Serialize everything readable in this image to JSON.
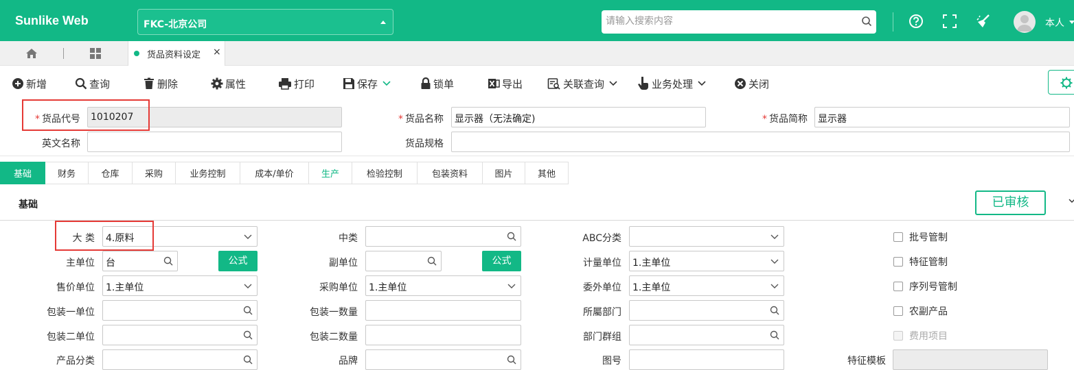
{
  "app": {
    "brand": "Sunlike Web",
    "company": "FKC-北京公司",
    "search_placeholder": "请输入搜索内容",
    "user_name": "本人",
    "accent_color": "#12b886"
  },
  "tabs": {
    "current_doc": "货品资料设定",
    "close_glyph": "×"
  },
  "toolbar": {
    "items": [
      {
        "label": "新增",
        "icon": "plus-circle-icon"
      },
      {
        "label": "查询",
        "icon": "search-icon"
      },
      {
        "label": "删除",
        "icon": "trash-icon"
      },
      {
        "label": "属性",
        "icon": "gear-icon"
      },
      {
        "label": "打印",
        "icon": "printer-icon"
      },
      {
        "label": "保存",
        "icon": "save-icon"
      },
      {
        "label": "锁单",
        "icon": "lock-icon"
      },
      {
        "label": "导出",
        "icon": "excel-icon"
      },
      {
        "label": "关联查询",
        "icon": "related-query-icon"
      },
      {
        "label": "业务处理",
        "icon": "hand-icon"
      },
      {
        "label": "关闭",
        "icon": "close-circle-icon"
      }
    ]
  },
  "header_form": {
    "item_code_label": "货品代号",
    "item_code_value": "1010207",
    "item_name_label": "货品名称",
    "item_name_value": "显示器（无法确定)",
    "item_short_label": "货品简称",
    "item_short_value": "显示器",
    "english_name_label": "英文名称",
    "english_name_value": "",
    "spec_label": "货品规格",
    "spec_value": "",
    "required_mark": "*"
  },
  "subtabs": [
    "基础",
    "财务",
    "仓库",
    "采购",
    "业务控制",
    "成本/单价",
    "生产",
    "检验控制",
    "包装资料",
    "图片",
    "其他"
  ],
  "section": {
    "title": "基础",
    "status": "已审核"
  },
  "basic": {
    "major_class_label": "大 类",
    "major_class_value": "4.原料",
    "mid_class_label": "中类",
    "mid_class_value": "",
    "abc_label": "ABC分类",
    "abc_value": "",
    "main_unit_label": "主单位",
    "main_unit_value": "台",
    "formula_label": "公式",
    "sub_unit_label": "副单位",
    "sub_unit_value": "",
    "measure_unit_label": "计量单位",
    "measure_unit_value": "1.主单位",
    "sale_unit_label": "售价单位",
    "sale_unit_value": "1.主单位",
    "purchase_unit_label": "采购单位",
    "purchase_unit_value": "1.主单位",
    "outsource_unit_label": "委外单位",
    "outsource_unit_value": "1.主单位",
    "pack1_unit_label": "包装一单位",
    "pack1_unit_value": "",
    "pack1_qty_label": "包装一数量",
    "pack1_qty_value": "",
    "dept_label": "所屬部门",
    "dept_value": "",
    "pack2_unit_label": "包装二单位",
    "pack2_unit_value": "",
    "pack2_qty_label": "包装二数量",
    "pack2_qty_value": "",
    "dept_group_label": "部门群组",
    "dept_group_value": "",
    "product_class_label": "产品分类",
    "brand_label": "品牌",
    "drawing_label": "图号",
    "feature_template_label": "特征模板",
    "checkboxes": [
      {
        "label": "批号管制",
        "checked": false,
        "disabled": false
      },
      {
        "label": "特征管制",
        "checked": false,
        "disabled": false
      },
      {
        "label": "序列号管制",
        "checked": false,
        "disabled": false
      },
      {
        "label": "农副产品",
        "checked": false,
        "disabled": false
      },
      {
        "label": "费用项目",
        "checked": false,
        "disabled": true
      }
    ]
  }
}
